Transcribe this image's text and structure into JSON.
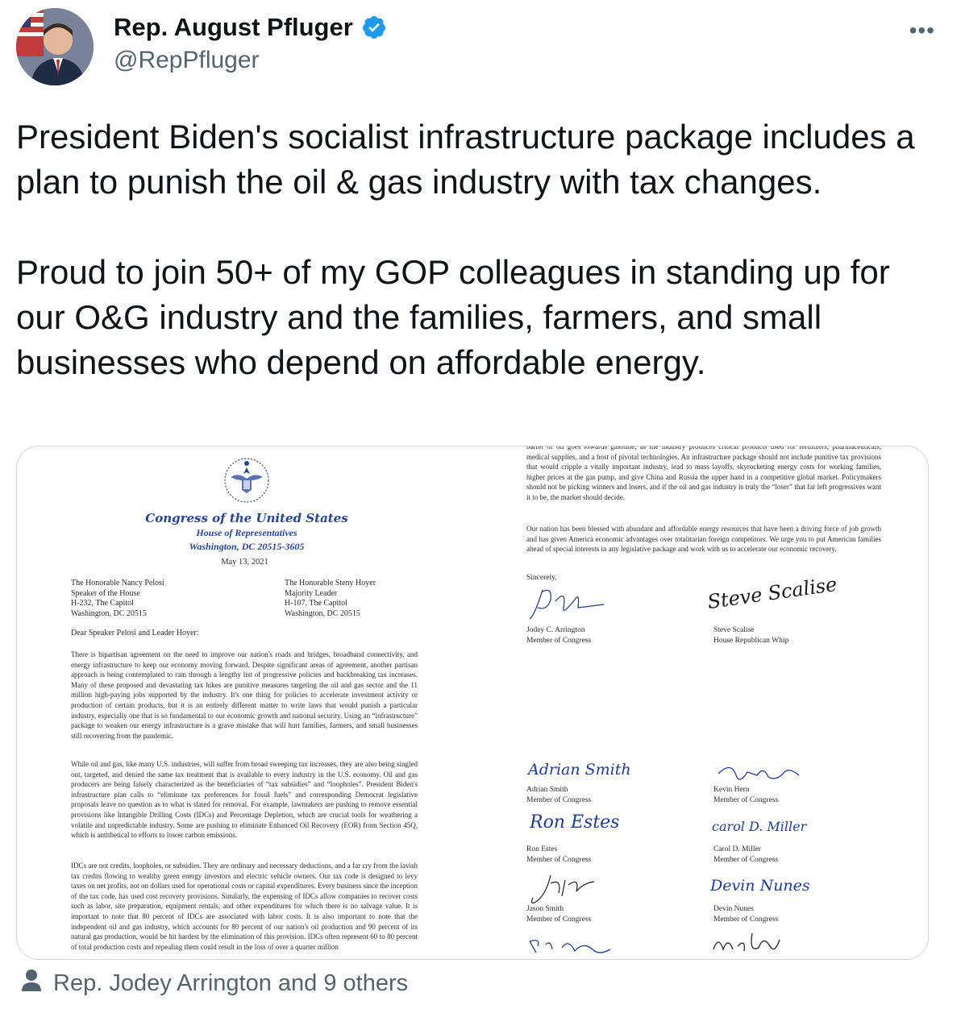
{
  "author": {
    "name": "Rep. August Pfluger",
    "handle": "@RepPfluger",
    "verified": true
  },
  "tweet": {
    "text": "President Biden's socialist infrastructure package includes a plan to punish the oil & gas industry with tax changes.\n\nProud to join 50+ of my GOP colleagues in standing up for our O&G industry and the families, farmers, and small businesses who depend on affordable energy."
  },
  "tagged": {
    "label": "Rep. Jodey Arrington and 9 others"
  },
  "letter": {
    "letterhead_line1": "Congress of the United States",
    "letterhead_line2": "House of Representatives",
    "letterhead_line3": "Washington, DC 20515-3605",
    "date": "May 13, 2021",
    "addressee_left": "The Honorable Nancy Pelosi\nSpeaker of the House\nH-232, The Capitol\nWashington, DC 20515",
    "addressee_right": "The Honorable Steny Hoyer\nMajority Leader\nH-107, The Capitol\nWashington, DC 20515",
    "salutation": "Dear Speaker Pelosi and Leader Hoyer:",
    "paragraph1": "There is bipartisan agreement on the need to improve our nation's roads and bridges, broadband connectivity, and energy infrastructure to keep our economy moving forward. Despite significant areas of agreement, another partisan approach is being contemplated to ram through a lengthy list of progressive policies and backbreaking tax increases. Many of these proposed and devastating tax hikes are punitive measures targeting the oil and gas sector and the 11 million high-paying jobs supported by the industry. It's one thing for policies to accelerate investment activity or production of certain products, but it is an entirely different matter to write laws that would punish a particular industry, especially one that is so fundamental to our economic growth and national security. Using an “infrastructure” package to weaken our energy infrastructure is a grave mistake that will hurt families, farmers, and small businesses still recovering from the pandemic.",
    "paragraph2": "While oil and gas, like many U.S. industries, will suffer from broad sweeping tax increases, they are also being singled out, targeted, and denied the same tax treatment that is available to every industry in the U.S. economy. Oil and gas producers are being falsely characterized as the beneficiaries of “tax subsidies” and “loopholes”. President Biden's infrastructure plan calls to “eliminate tax preferences for fossil fuels” and corresponding Democrat legislative proposals leave no question as to what is slated for removal. For example, lawmakers are pushing to remove essential provisions like Intangible Drilling Costs (IDCs) and Percentage Depletion, which are crucial tools for weathering a volatile and unpredictable industry. Some are pushing to eliminate Enhanced Oil Recovery (EOR) from Section 45Q, which is antithetical to efforts to lower carbon emissions.",
    "paragraph3": "IDCs are not credits, loopholes, or subsidies. They are ordinary and necessary deductions, and a far cry from the lavish tax credits flowing to wealthy green energy investors and electric vehicle owners. Our tax code is designed to levy taxes on net profits, not on dollars used for operational costs or capital expenditures. Every business since the inception of the tax code, has used cost recovery provisions. Similarly, the expensing of IDCs allow companies to recover costs such as labor, site preparation, equipment rentals, and other expenditures for which there is no salvage value. It is important to note that 80 percent of IDCs are associated with labor costs. It is also important to note that the independent oil and gas industry, which accounts for 80 percent of our nation's oil production and 90 percent of its natural gas production, would be hit hardest by the elimination of this provision. IDCs often represent 60 to 80 percent of total production costs and repealing them could result in the loss of over a quarter million",
    "right_paragraph0": "barrel of oil goes towards gasoline, as the industry produces critical products used for fertilizers, pharmaceuticals, medical supplies, and a host of pivotal technologies. An infrastructure package should not include punitive tax provisions that would cripple a vitally important industry, lead to mass layoffs, skyrocketing energy costs for working families, higher prices at the gas pump, and give China and Russia the upper hand in a competitive global market. Policymakers should not be picking winners and losers, and if the oil and gas industry is truly the “loser” that far left progressives want it to be, the market should decide.",
    "right_paragraph1": "Our nation has been blessed with abundant and affordable energy resources that have been a driving force of job growth and has given America economic advantages over totalitarian foreign competitors. We urge you to put American families ahead of special interests in any legislative package and work with us to accelerate our economic recovery.",
    "closing": "Sincerely,",
    "signatories": [
      {
        "name": "Jodey C. Arrington",
        "title": "Member of Congress"
      },
      {
        "name": "Steve Scalise",
        "title": "House Republican Whip"
      },
      {
        "name": "Adrian Smith",
        "title": "Member of Congress"
      },
      {
        "name": "Kevin Hern",
        "title": "Member of Congress"
      },
      {
        "name": "Ron Estes",
        "title": "Member of Congress"
      },
      {
        "name": "Carol D. Miller",
        "title": "Member of Congress"
      },
      {
        "name": "Jason Smith",
        "title": "Member of Congress"
      },
      {
        "name": "Devin Nunes",
        "title": "Member of Congress"
      }
    ],
    "signature_scrawls": [
      "Steve Scalise",
      "Adrian Smith",
      "Ron Estes",
      "carol D. Miller",
      "Devin Nunes"
    ]
  },
  "colors": {
    "text": "#0f1419",
    "secondary": "#536471",
    "verified": "#1d9bf0",
    "letterhead": "#28449a",
    "signature_ink": "#1f3a9a"
  },
  "icons": {
    "verified": "verified-badge-icon",
    "more": "more-icon",
    "tagged": "person-icon"
  }
}
